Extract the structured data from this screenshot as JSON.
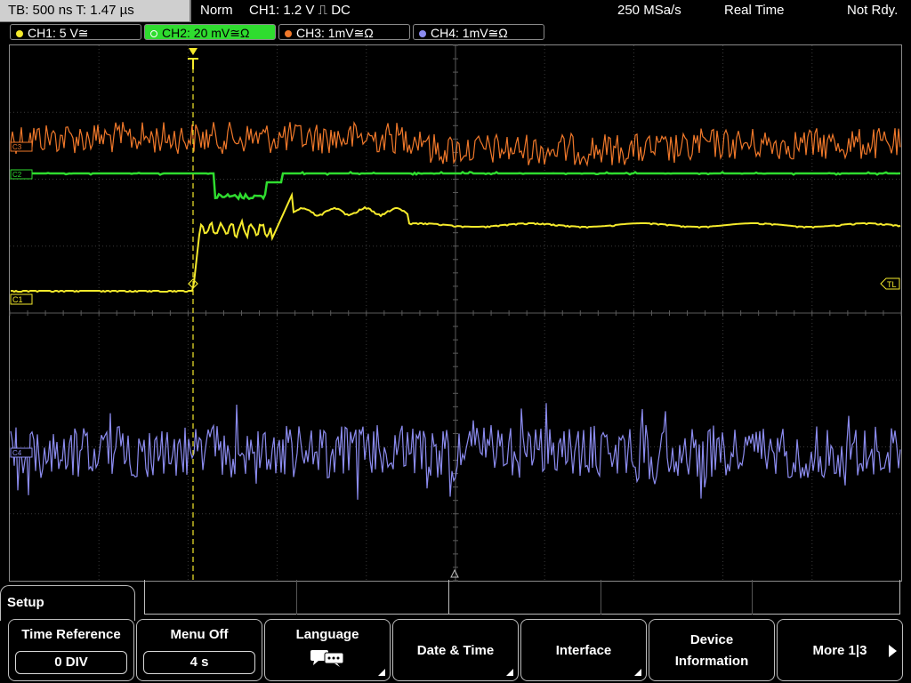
{
  "status": {
    "timebase": "TB: 500 ns   T: 1.47 µs",
    "mode": "Norm",
    "trigger": "CH1: 1.2 V ⎍ DC",
    "sample_rate": "250 MSa/s",
    "acq_mode": "Real Time",
    "state": "Not Rdy."
  },
  "channels": [
    {
      "label": "CH1: 5 V≅",
      "color": "#f5ea2c",
      "active": false
    },
    {
      "label": "CH2: 20 mV≅Ω",
      "color": "#2fdc2f",
      "active": true
    },
    {
      "label": "CH3: 1mV≅Ω",
      "color": "#f0782a",
      "active": false
    },
    {
      "label": "CH4: 1mV≅Ω",
      "color": "#8c8cf0",
      "active": false
    }
  ],
  "markers": {
    "c3": "C3",
    "c2": "C2",
    "c1": "C1",
    "c4": "C4",
    "trigger_level": "TL"
  },
  "menu": {
    "title": "Setup",
    "softkeys": [
      {
        "label": "Time Reference",
        "value": "0 DIV"
      },
      {
        "label": "Menu Off",
        "value": "4 s"
      },
      {
        "label": "Language",
        "icon": "speech-bubbles-icon"
      },
      {
        "label": "Date & Time"
      },
      {
        "label": "Interface"
      },
      {
        "label_line1": "Device",
        "label_line2": "Information"
      },
      {
        "label": "More 1|3"
      }
    ]
  },
  "colors": {
    "ch1": "#f5ea2c",
    "ch2": "#2fdc2f",
    "ch3": "#f0782a",
    "ch4": "#8c8cf0",
    "grid": "#6a6a6a",
    "status_bg": "#cfcfcf"
  }
}
